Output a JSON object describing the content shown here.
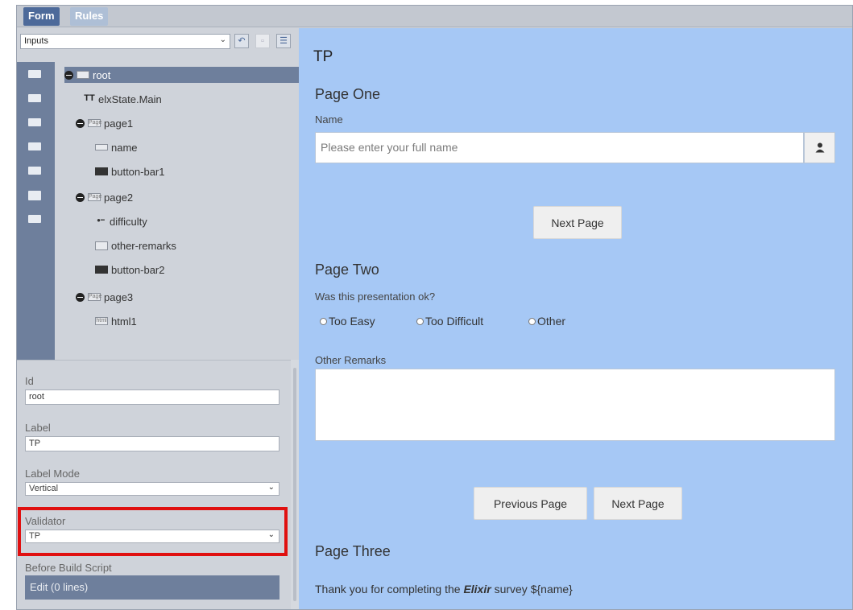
{
  "tabs": {
    "form": "Form",
    "rules": "Rules"
  },
  "toolbar": {
    "inputs_select": "Inputs",
    "undo_icon": "undo-icon",
    "menu_icon": "menu-icon"
  },
  "tree": {
    "root": "root",
    "state": "elxState.Main",
    "page1": "page1",
    "name": "name",
    "button_bar1": "button-bar1",
    "page2": "page2",
    "difficulty": "difficulty",
    "other_remarks": "other-remarks",
    "button_bar2": "button-bar2",
    "page3": "page3",
    "html1": "html1"
  },
  "props": {
    "id_label": "Id",
    "id_value": "root",
    "label_label": "Label",
    "label_value": "TP",
    "label_mode_label": "Label Mode",
    "label_mode_value": "Vertical",
    "validator_label": "Validator",
    "validator_value": "TP",
    "before_build_label": "Before Build Script",
    "edit_button": "Edit (0 lines)"
  },
  "preview": {
    "form_title": "TP",
    "page_one_title": "Page One",
    "name_label": "Name",
    "name_placeholder": "Please enter your full name",
    "next_page_1": "Next Page",
    "page_two_title": "Page Two",
    "question": "Was this presentation ok?",
    "radio_too_easy": "Too Easy",
    "radio_too_difficult": "Too Difficult",
    "radio_other": "Other",
    "other_remarks_label": "Other Remarks",
    "previous_page": "Previous Page",
    "next_page_2": "Next Page",
    "page_three_title": "Page Three",
    "thanks_before": "Thank you for completing the ",
    "thanks_bold": "Elixir",
    "thanks_after": " survey ${name}"
  },
  "colors": {
    "preview_bg": "#a6c8f5",
    "sidebar_accent": "#6e7f9c",
    "tab_active": "#4d6a9a",
    "highlight": "#e01010"
  }
}
